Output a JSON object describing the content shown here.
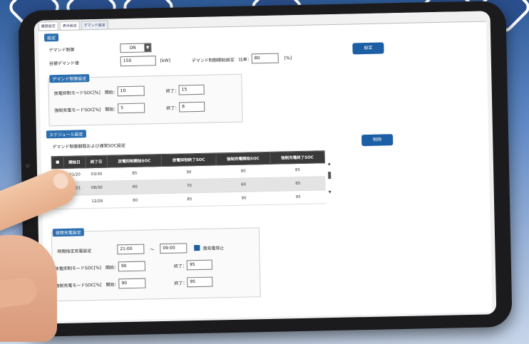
{
  "tabs": [
    "履歴設定",
    "表示設定",
    "デマンド設定"
  ],
  "settings": {
    "section_label": "設定",
    "demand_control_label": "デマンド制御",
    "demand_control_value": "ON",
    "target_demand_label": "目標デマンド値",
    "target_demand_value": "150",
    "target_demand_unit": "[kW]",
    "start_setting_label": "デマンド制御開始設定　比率：",
    "start_setting_value": "80",
    "start_setting_unit": "[%]",
    "set_button": "設定"
  },
  "demand_period": {
    "section_label": "デマンド制御設定",
    "discharge_label": "放電抑制モードSOC[%]　開始：",
    "discharge_start": "10",
    "discharge_end_label": "終了：",
    "discharge_end": "15",
    "charge_label": "強制充電モードSOC[%]　開始：",
    "charge_start": "5",
    "charge_end_label": "終了：",
    "charge_end": "8"
  },
  "schedule": {
    "section_label": "スケジュール設定",
    "subtitle": "デマンド制御期間および通常SOC設定",
    "columns": [
      "■",
      "開始日",
      "終了日",
      "放電抑制開始SOC",
      "放電抑制終了SOC",
      "強制充電開始SOC",
      "強制充電終了SOC"
    ],
    "rows": [
      {
        "start": "01/20",
        "end": "03/30",
        "c1": "85",
        "c2": "90",
        "c3": "80",
        "c4": "85"
      },
      {
        "start": "08/01",
        "end": "08/30",
        "c1": "60",
        "c2": "70",
        "c3": "60",
        "c4": "65"
      },
      {
        "start": "",
        "end": "12/28",
        "c1": "80",
        "c2": "85",
        "c3": "90",
        "c4": "95"
      }
    ],
    "delete_button": "削除"
  },
  "night_charge": {
    "section_label": "夜間充電設定",
    "time_label": "時間指定充電設定",
    "time_from": "21:00",
    "tilde": "〜",
    "time_to": "09:00",
    "stop_label": "満充電停止",
    "discharge_label": "放電抑制モードSOC[%]　開始：",
    "discharge_start": "90",
    "discharge_end_label": "終了：",
    "discharge_end": "95",
    "charge_label": "強制充電モードSOC[%]　開始：",
    "charge_start": "90",
    "charge_end_label": "終了：",
    "charge_end": "95"
  },
  "colors": {
    "accent": "#1d5fa5",
    "section": "#2b6fb0",
    "header": "#3a3a3a"
  }
}
